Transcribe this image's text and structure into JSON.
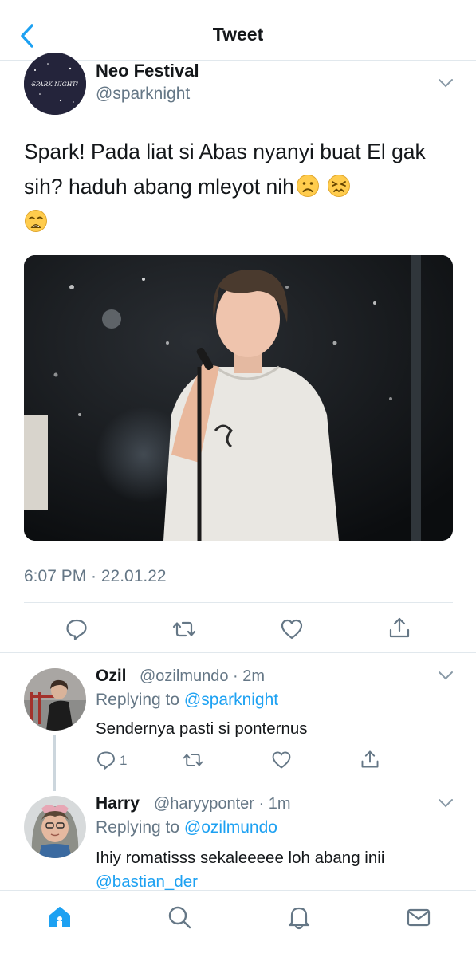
{
  "header": {
    "title": "Tweet"
  },
  "tweet": {
    "author_name": "Neo Festival",
    "author_handle": "@sparknight",
    "avatar_text": "SPARK NIGHT!",
    "text": "Spark! Pada liat si Abas nyanyi buat El gak sih? haduh abang mleyot nih",
    "timestamp": "6:07 PM · 22.01.22"
  },
  "replies": [
    {
      "name": "Ozil",
      "handle": "@ozilmundo",
      "time": "· 2m",
      "replying_label": "Replying to",
      "replying_to": "@sparknight",
      "text": "Sendernya pasti si ponternus",
      "reply_count": "1"
    },
    {
      "name": "Harry",
      "handle": "@haryyponter",
      "time": "· 1m",
      "replying_label": "Replying to",
      "replying_to": "@ozilmundo",
      "text": "Ihiy romatisss sekaleeeee loh abang inii",
      "mention": "@bastian_der"
    }
  ],
  "icons": {
    "back": "chevron-left-icon",
    "more": "chevron-down-icon",
    "reply": "comment-icon",
    "retweet": "retweet-icon",
    "like": "heart-icon",
    "share": "share-icon",
    "tabs": [
      "home-icon",
      "search-icon",
      "bell-icon",
      "mail-icon"
    ]
  },
  "colors": {
    "accent": "#1da1f2",
    "muted": "#657786",
    "text": "#14171a",
    "divider": "#e1e8ed"
  }
}
